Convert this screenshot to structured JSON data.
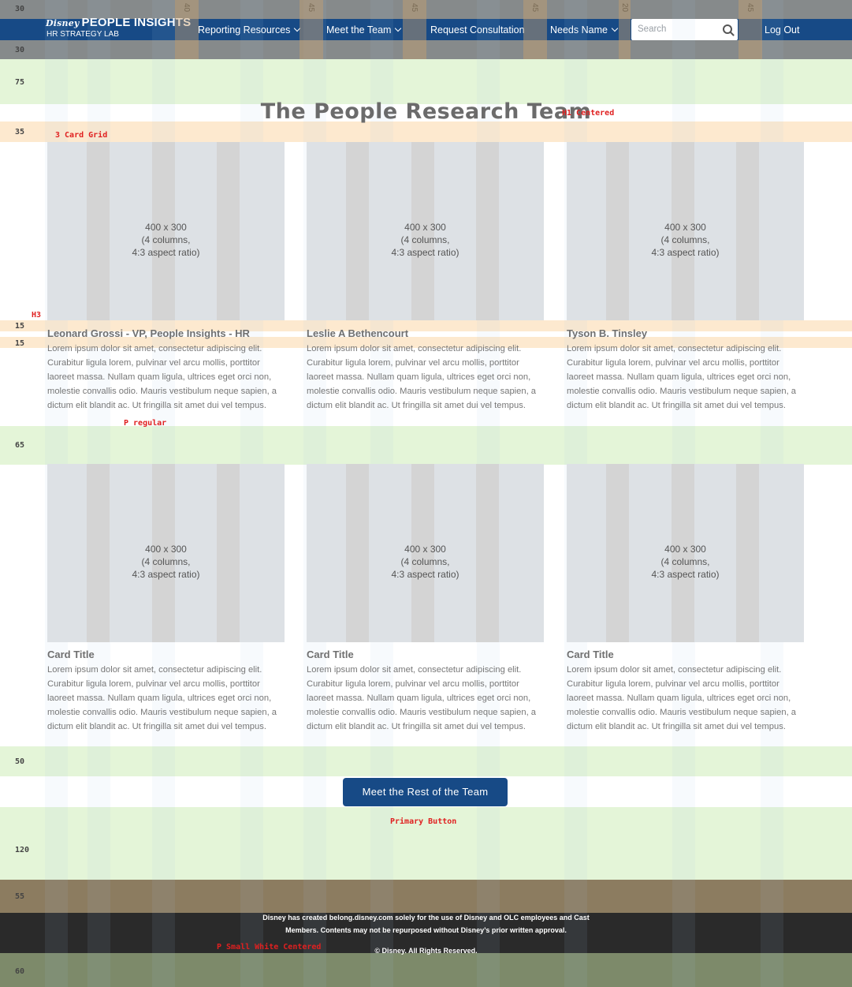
{
  "header": {
    "brand": "Disney",
    "logo_title": "PEOPLE INSIGHTS",
    "logo_subtitle": "HR STRATEGY LAB",
    "nav": [
      {
        "label": "Reporting Resources"
      },
      {
        "label": "Meet the Team"
      },
      {
        "label": "Request Consultation"
      },
      {
        "label": "Needs Name"
      }
    ],
    "search_placeholder": "Search",
    "logout_label": "Log Out"
  },
  "spacing_labels": {
    "top": "30",
    "nav_bottom": "30",
    "hero": "75",
    "grid_top": "35",
    "title_gap": "15",
    "text_gap": "15",
    "row_gap": "65",
    "button_gap": "50",
    "footer_gap": "120",
    "footer_top": "55",
    "footer_bottom": "60"
  },
  "gutter_labels": [
    "40",
    "45",
    "45",
    "45",
    "20",
    "45"
  ],
  "page_title": "The People Research Team",
  "annotations": {
    "h1": "H1 Centered",
    "grid": "3 Card Grid",
    "h3": "H3",
    "p": "P regular",
    "button": "Primary Button",
    "footer": "P Small White Centered"
  },
  "placeholder": {
    "size": "400 x 300",
    "columns": "(4 columns,",
    "ratio": "4:3 aspect ratio)"
  },
  "cards": [
    {
      "title": "Leonard Grossi - VP, People Insights - HR"
    },
    {
      "title": "Leslie A Bethencourt"
    },
    {
      "title": "Tyson B. Tinsley"
    },
    {
      "title": "Card Title"
    },
    {
      "title": "Card Title"
    },
    {
      "title": "Card Title"
    }
  ],
  "body_text": "Lorem ipsum dolor sit amet, consectetur adipiscing elit. Curabitur ligula lorem, pulvinar vel arcu mollis, porttitor laoreet massa. Nullam quam ligula, ultrices eget orci non, molestie convallis odio. Mauris vestibulum neque sapien, a dictum elit blandit ac. Ut fringilla sit amet dui vel tempus.",
  "cta_label": "Meet the Rest of the Team",
  "footer": {
    "line1": "Disney has created belong.disney.com solely for the use of Disney and OLC employees and Cast",
    "line2": "Members. Contents may not be repurposed without Disney’s prior written approval.",
    "copyright": "© Disney. All Rights Reserved."
  }
}
